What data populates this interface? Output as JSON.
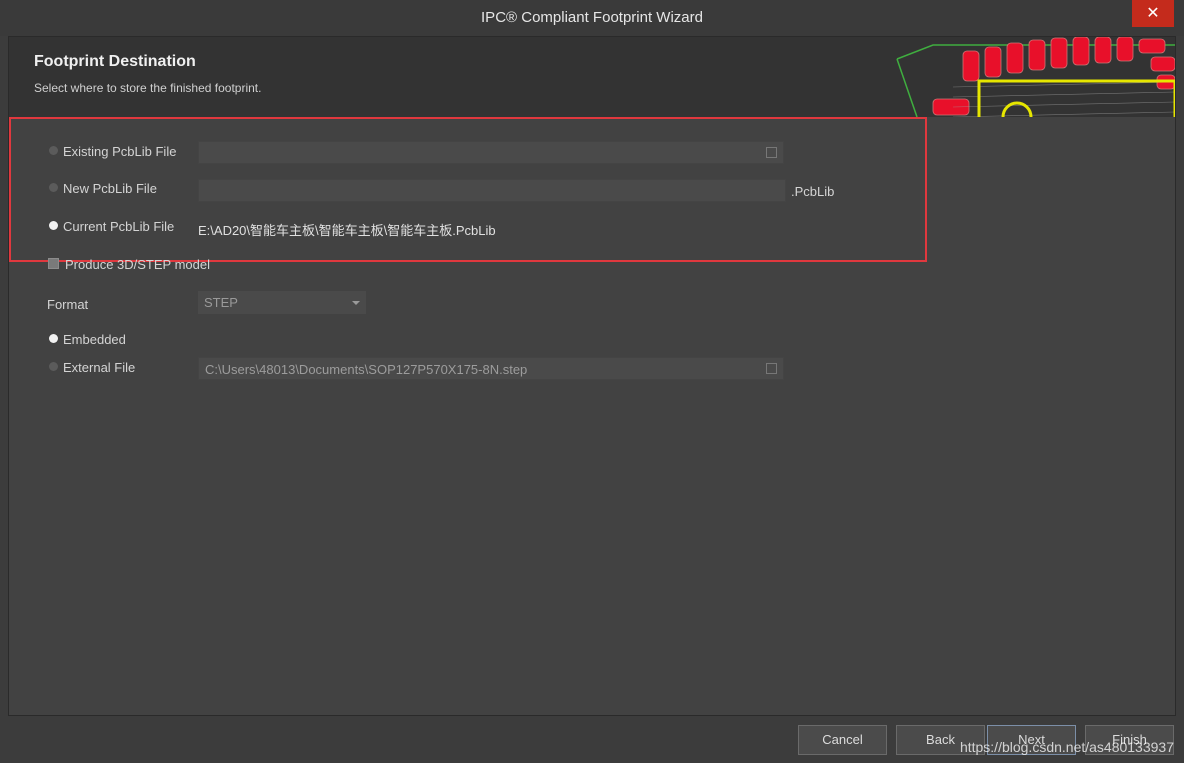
{
  "window": {
    "title": "IPC® Compliant Footprint Wizard",
    "close_glyph": "✕"
  },
  "header": {
    "title": "Footprint Destination",
    "subtitle": "Select where to store the finished footprint."
  },
  "destination": {
    "existing_label": "Existing PcbLib File",
    "existing_value": "",
    "new_label": "New PcbLib File",
    "new_value": "",
    "new_suffix": ".PcbLib",
    "current_label": "Current PcbLib File",
    "current_value": "E:\\AD20\\智能车主板\\智能车主板\\智能车主板.PcbLib",
    "selected": "current"
  },
  "model": {
    "produce_label": "Produce 3D/STEP model",
    "produce_checked": true,
    "format_label": "Format",
    "format_value": "STEP",
    "embedded_label": "Embedded",
    "external_label": "External File",
    "external_value": "C:\\Users\\48013\\Documents\\SOP127P570X175-8N.step",
    "selected": "embedded"
  },
  "buttons": {
    "cancel": "Cancel",
    "back": "Back",
    "next": "Next",
    "finish": "Finish"
  },
  "watermark": "https://blog.csdn.net/as480133937",
  "colors": {
    "highlight_box": "#e0383e",
    "pad_red": "#e8102a",
    "outline_yellow": "#e6e600",
    "title_close": "#c42b1c"
  }
}
